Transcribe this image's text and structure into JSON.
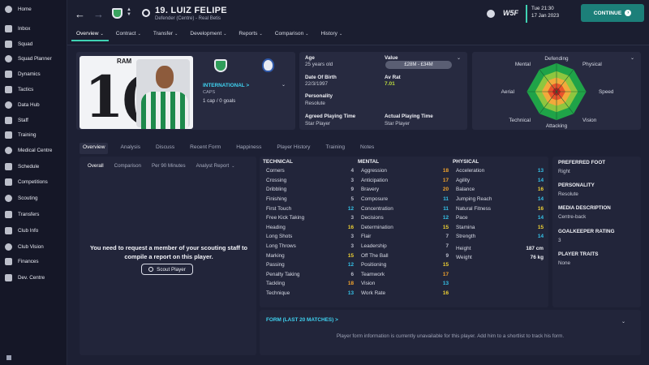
{
  "sidebar": {
    "items": [
      {
        "label": "Home",
        "icon": "home-icon"
      },
      {
        "label": "Inbox",
        "icon": "inbox-icon"
      },
      {
        "label": "Squad",
        "icon": "squad-icon"
      },
      {
        "label": "Squad Planner",
        "icon": "planner-icon"
      },
      {
        "label": "Dynamics",
        "icon": "dynamics-icon"
      },
      {
        "label": "Tactics",
        "icon": "tactics-icon"
      },
      {
        "label": "Data Hub",
        "icon": "data-hub-icon"
      },
      {
        "label": "Staff",
        "icon": "staff-icon"
      },
      {
        "label": "Training",
        "icon": "training-icon"
      },
      {
        "label": "Medical Centre",
        "icon": "medical-icon"
      },
      {
        "label": "Schedule",
        "icon": "schedule-icon"
      },
      {
        "label": "Competitions",
        "icon": "trophy-icon"
      },
      {
        "label": "Scouting",
        "icon": "scouting-icon"
      },
      {
        "label": "Transfers",
        "icon": "transfers-icon"
      },
      {
        "label": "Club Info",
        "icon": "club-info-icon"
      },
      {
        "label": "Club Vision",
        "icon": "vision-icon"
      },
      {
        "label": "Finances",
        "icon": "finances-icon"
      },
      {
        "label": "Dev. Centre",
        "icon": "dev-centre-icon"
      }
    ]
  },
  "header": {
    "title": "19. LUIZ FELIPE",
    "subtitle": "Defender (Centre) - Real Betis",
    "logo_text": "W5F",
    "date_day": "Tue 21:30",
    "date": "17 Jan 2023",
    "continue_label": "CONTINUE",
    "menu": [
      "Overview",
      "Contract",
      "Transfer",
      "Development",
      "Reports",
      "Comparison",
      "History"
    ]
  },
  "photo": {
    "name_fragment": "RAM",
    "shirt_number_fragment": "1("
  },
  "international": {
    "title": "INTERNATIONAL >",
    "caps_label": "CAPS",
    "caps_value": "1 cap / 0 goals"
  },
  "info": {
    "age_label": "Age",
    "age_value": "25 years old",
    "value_label": "Value",
    "value_value": "£28M - £34M",
    "dob_label": "Date Of Birth",
    "dob_value": "22/3/1997",
    "avrat_label": "Av Rat",
    "avrat_value": "7.01",
    "personality_label": "Personality",
    "personality_value": "Resolute",
    "agreed_label": "Agreed Playing Time",
    "agreed_value": "Star Player",
    "actual_label": "Actual Playing Time",
    "actual_value": "Star Player"
  },
  "radar": {
    "labels": [
      "Defending",
      "Physical",
      "Speed",
      "Vision",
      "Attacking",
      "Technical",
      "Aerial",
      "Mental"
    ],
    "colors": {
      "outer": "#1fa348",
      "mid1": "#8ec63f",
      "mid2": "#f2a93b",
      "inner": "#e9532b",
      "core": "#c8161d"
    }
  },
  "tabs": [
    "Overview",
    "Analysis",
    "Discuss",
    "Recent Form",
    "Happiness",
    "Player History",
    "Training",
    "Notes"
  ],
  "subtabs": [
    "Overall",
    "Comparison",
    "Per 90 Minutes",
    "Analyst Report"
  ],
  "scouting": {
    "message": "You need to request a member of your scouting staff to compile a report on this player.",
    "button": "Scout Player"
  },
  "attributes": {
    "technical_header": "TECHNICAL",
    "mental_header": "MENTAL",
    "physical_header": "PHYSICAL",
    "technical": [
      {
        "name": "Corners",
        "value": "4"
      },
      {
        "name": "Crossing",
        "value": "3"
      },
      {
        "name": "Dribbling",
        "value": "9"
      },
      {
        "name": "Finishing",
        "value": "5"
      },
      {
        "name": "First Touch",
        "value": "12"
      },
      {
        "name": "Free Kick Taking",
        "value": "3"
      },
      {
        "name": "Heading",
        "value": "16"
      },
      {
        "name": "Long Shots",
        "value": "3"
      },
      {
        "name": "Long Throws",
        "value": "3"
      },
      {
        "name": "Marking",
        "value": "15"
      },
      {
        "name": "Passing",
        "value": "12"
      },
      {
        "name": "Penalty Taking",
        "value": "6"
      },
      {
        "name": "Tackling",
        "value": "18"
      },
      {
        "name": "Technique",
        "value": "13"
      }
    ],
    "mental": [
      {
        "name": "Aggression",
        "value": "18"
      },
      {
        "name": "Anticipation",
        "value": "17"
      },
      {
        "name": "Bravery",
        "value": "20"
      },
      {
        "name": "Composure",
        "value": "11"
      },
      {
        "name": "Concentration",
        "value": "11"
      },
      {
        "name": "Decisions",
        "value": "12"
      },
      {
        "name": "Determination",
        "value": "15"
      },
      {
        "name": "Flair",
        "value": "7"
      },
      {
        "name": "Leadership",
        "value": "7"
      },
      {
        "name": "Off The Ball",
        "value": "9"
      },
      {
        "name": "Positioning",
        "value": "15"
      },
      {
        "name": "Teamwork",
        "value": "17"
      },
      {
        "name": "Vision",
        "value": "13"
      },
      {
        "name": "Work Rate",
        "value": "16"
      }
    ],
    "physical": [
      {
        "name": "Acceleration",
        "value": "13"
      },
      {
        "name": "Agility",
        "value": "14"
      },
      {
        "name": "Balance",
        "value": "16"
      },
      {
        "name": "Jumping Reach",
        "value": "14"
      },
      {
        "name": "Natural Fitness",
        "value": "16"
      },
      {
        "name": "Pace",
        "value": "14"
      },
      {
        "name": "Stamina",
        "value": "15"
      },
      {
        "name": "Strength",
        "value": "14"
      }
    ],
    "height_label": "Height",
    "height_value": "187 cm",
    "weight_label": "Weight",
    "weight_value": "76 kg"
  },
  "details": {
    "foot_label": "PREFERRED FOOT",
    "foot_value": "Right",
    "personality_label": "PERSONALITY",
    "personality_value": "Resolute",
    "media_label": "MEDIA DESCRIPTION",
    "media_value": "Centre-back",
    "gk_label": "GOALKEEPER RATING",
    "gk_value": "3",
    "traits_label": "PLAYER TRAITS",
    "traits_value": "None"
  },
  "form": {
    "title": "FORM (LAST 20 MATCHES) >",
    "message": "Player form information is currently unavailable for this player. Add him to a shortlist to track his form."
  }
}
